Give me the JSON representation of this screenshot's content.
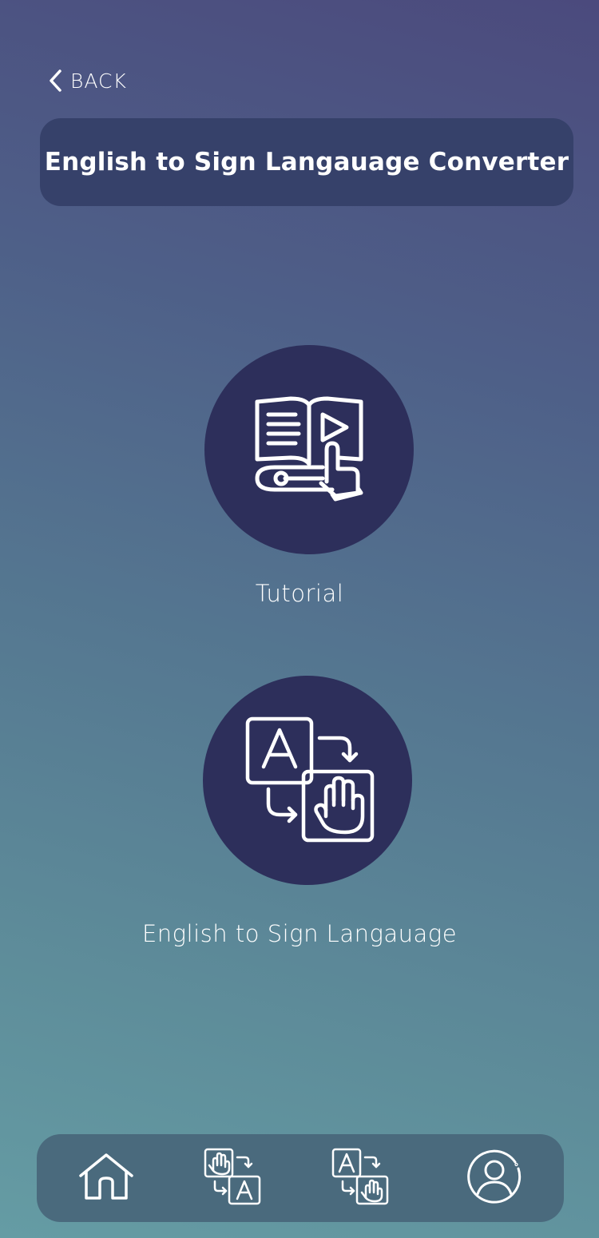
{
  "nav": {
    "back_label": "BACK"
  },
  "header": {
    "title": "English to Sign Langauage Converter"
  },
  "features": [
    {
      "label": "Tutorial",
      "icon": "tutorial-book-play-icon"
    },
    {
      "label": "English to Sign Langauage",
      "icon": "text-to-sign-icon"
    }
  ],
  "bottom_nav": {
    "items": [
      {
        "icon": "home-icon"
      },
      {
        "icon": "sign-to-text-icon"
      },
      {
        "icon": "text-to-sign-icon"
      },
      {
        "icon": "profile-icon"
      }
    ]
  },
  "colors": {
    "title_bar": "#36416a",
    "circle": "#2d2f5b",
    "nav_bar": "#4a6a7d",
    "foreground": "#ffffff"
  }
}
